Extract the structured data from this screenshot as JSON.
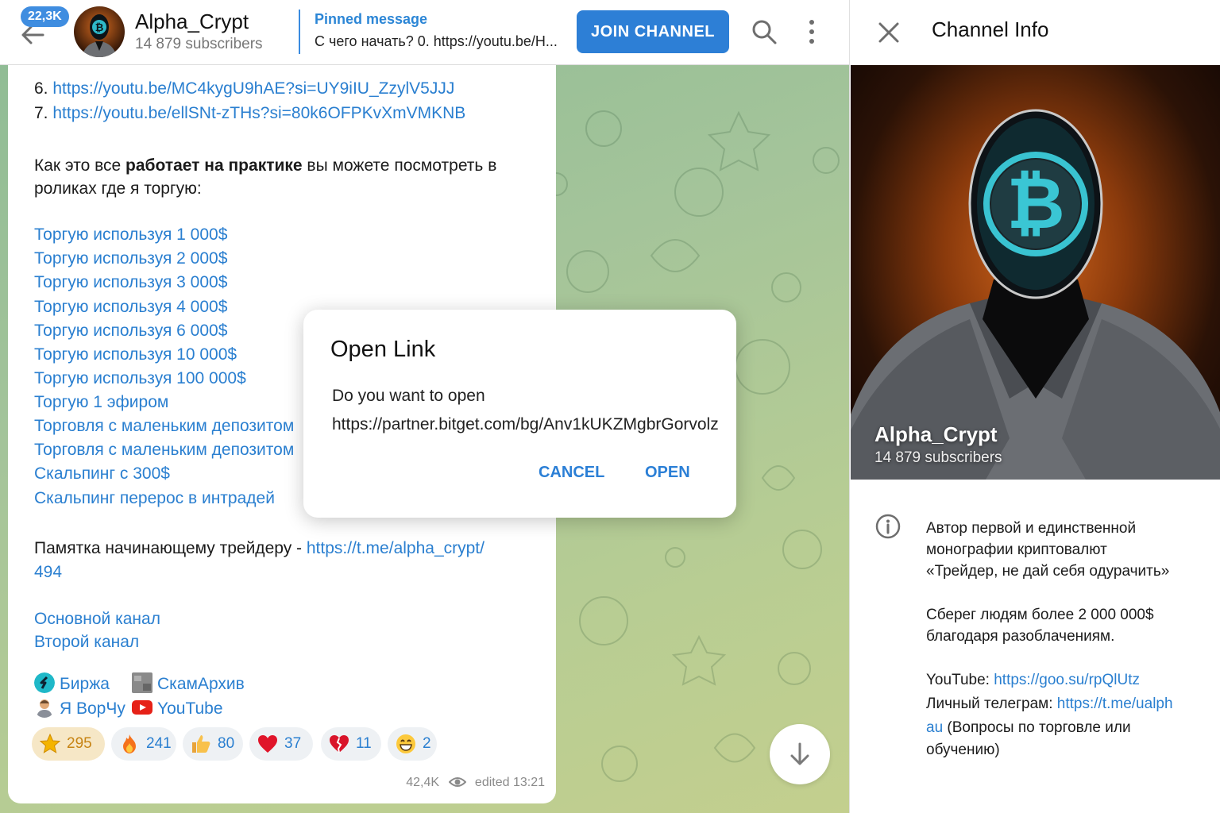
{
  "header": {
    "unread_badge": "22,3K",
    "channel_title": "Alpha_Crypt",
    "subscribers": "14 879 subscribers",
    "pinned_label": "Pinned message",
    "pinned_text": "С чего начать? 0. https://youtu.be/H...",
    "join_label": "JOIN CHANNEL"
  },
  "message": {
    "list_items": [
      {
        "num": "6.",
        "url": "https://youtu.be/MC4kygU9hAE?si=UY9iIU_ZzylV5JJJ"
      },
      {
        "num": "7.",
        "url": "https://youtu.be/ellSNt-zTHs?si=80k6OFPKvXmVMKNB"
      }
    ],
    "practice_pre": "Как это все ",
    "practice_bold": "работает на практике",
    "practice_post": " вы можете посмотреть в",
    "practice_line2": "роликах где я торгую:",
    "video_links": [
      "Торгую используя 1 000$",
      "Торгую используя 2 000$",
      "Торгую используя 3 000$",
      "Торгую используя 4 000$",
      "Торгую используя 6 000$",
      "Торгую используя 10 000$",
      "Торгую используя 100 000$",
      "Торгую 1 эфиром",
      "Торговля с маленьким депозитом",
      "Торговля с маленьким депозитом",
      "Скальпинг с 300$",
      "Скальпинг перерос в интрадей"
    ],
    "memo_text": "Памятка начинающему трейдеру - ",
    "memo_link": "https://t.me/alpha_crypt/",
    "memo_link_cont": "494",
    "main_channel": "Основной канал",
    "second_channel": "Второй канал",
    "birzha": "Биржа",
    "scam_archive": "СкамАрхив",
    "ya_vorchu": "Я ВорЧу",
    "youtube": "YouTube",
    "reactions": [
      {
        "emoji": "star-icon",
        "count": "295"
      },
      {
        "emoji": "fire-icon",
        "count": "241"
      },
      {
        "emoji": "thumbs-up-icon",
        "count": "80"
      },
      {
        "emoji": "heart-icon",
        "count": "37"
      },
      {
        "emoji": "broken-heart-icon",
        "count": "11"
      },
      {
        "emoji": "grin-icon",
        "count": "2"
      }
    ],
    "views": "42,4K",
    "edited": "edited 13:21"
  },
  "dialog": {
    "title": "Open Link",
    "question": "Do you want to open",
    "url": "https://partner.bitget.com/bg/Anv1kUKZMgbrGorvolz",
    "cancel": "CANCEL",
    "open": "OPEN"
  },
  "info_panel": {
    "title": "Channel Info",
    "name": "Alpha_Crypt",
    "subscribers": "14 879 subscribers",
    "desc_lines": [
      "Автор первой и единственной",
      "монографии криптовалют",
      "«Трейдер, не дай себя одурачить»"
    ],
    "desc_lines2": [
      "Сберег людям более 2 000 000$",
      "благодаря разоблачениям."
    ],
    "youtube_label": "YouTube: ",
    "youtube_link": "https://goo.su/rpQlUtz",
    "telegram_label": "Личный телеграм: ",
    "telegram_link_a": "https://t.me/ualph",
    "telegram_link_b": "au",
    "telegram_note_a": " (Вопросы по торговле или",
    "telegram_note_b": "обучению)"
  },
  "colors": {
    "accent": "#2d7fd6",
    "link": "#2a7fd0",
    "wallpaper_green": "#a4c49a",
    "reaction_active": "#f6e7c6"
  }
}
